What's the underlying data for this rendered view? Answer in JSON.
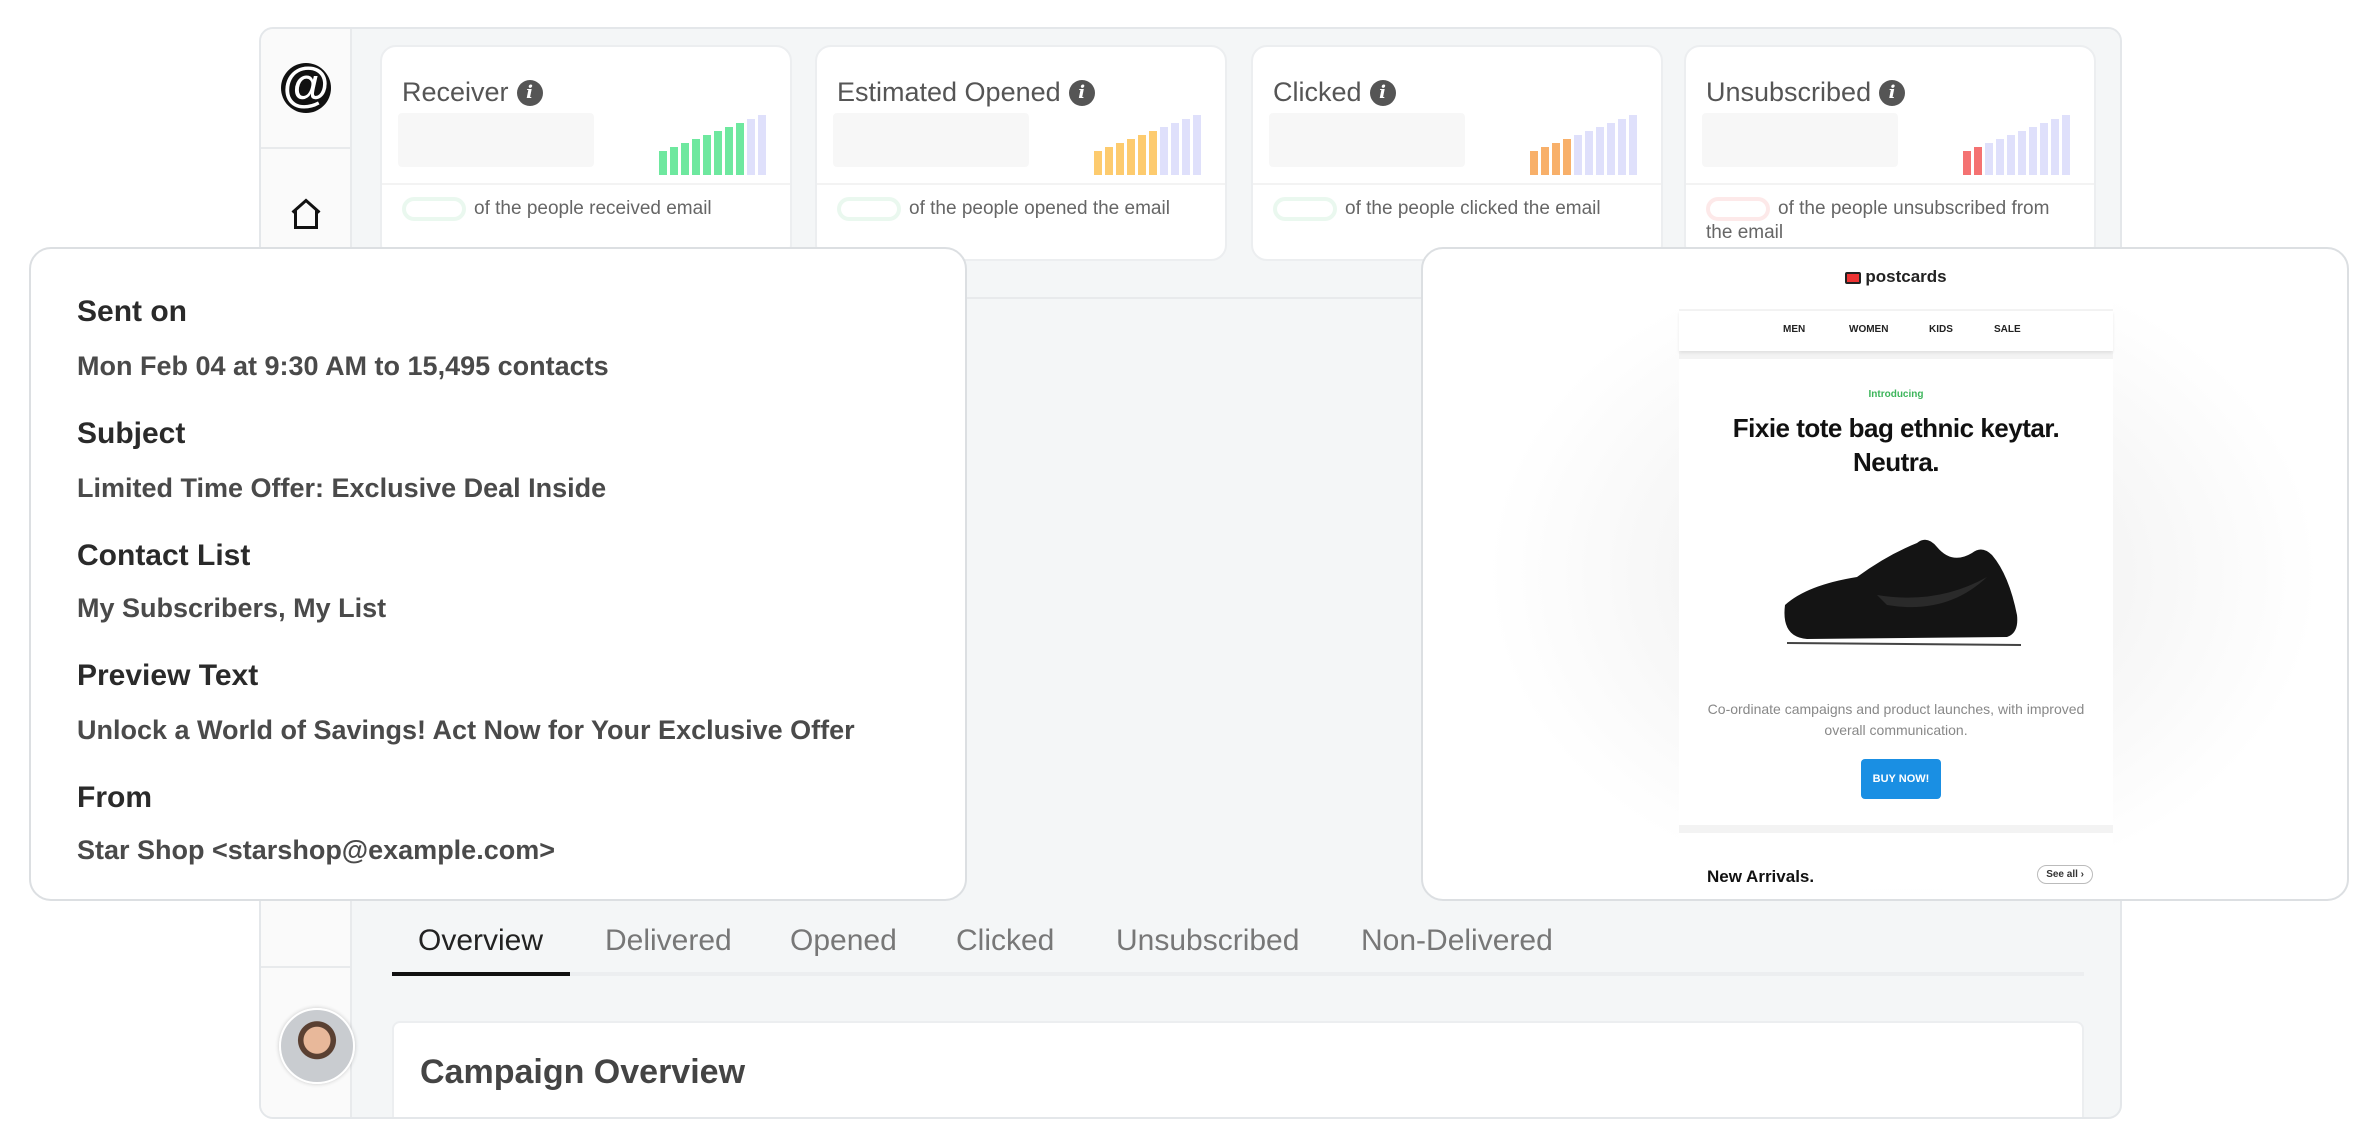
{
  "sidebar": {
    "logo": "@",
    "items": [
      {
        "icon": "home-icon"
      }
    ],
    "avatar": "user-avatar"
  },
  "stats": [
    {
      "title": "Receiver",
      "caption": "of the people received email",
      "bars_filled": 8,
      "bars_total": 10,
      "color": "#6ee89f"
    },
    {
      "title": "Estimated Opened",
      "caption": "of the people opened the email",
      "bars_filled": 6,
      "bars_total": 10,
      "color": "#fdcb6e"
    },
    {
      "title": "Clicked",
      "caption": "of the people clicked the email",
      "bars_filled": 4,
      "bars_total": 10,
      "color": "#f8b06a"
    },
    {
      "title": "Unsubscribed",
      "caption": "of the people unsubscribed from the email",
      "bars_filled": 2,
      "bars_total": 10,
      "color": "#f47272"
    }
  ],
  "inactive_bar_color": "#dfe0fb",
  "details": {
    "sent_on_label": "Sent on",
    "sent_on": "Mon Feb 04 at 9:30 AM to 15,495 contacts",
    "subject_label": "Subject",
    "subject": "Limited Time Offer: Exclusive Deal Inside",
    "contact_list_label": "Contact List",
    "contact_list": "My Subscribers, My List",
    "preview_label": "Preview Text",
    "preview": "Unlock a World of Savings! Act Now for Your Exclusive Offer",
    "from_label": "From",
    "from": "Star Shop <starshop@example.com>"
  },
  "email": {
    "brand": "postcards",
    "nav": [
      "MEN",
      "WOMEN",
      "KIDS",
      "SALE"
    ],
    "intro": "Introducing",
    "headline": "Fixie tote bag ethnic keytar. Neutra.",
    "body": "Co-ordinate campaigns and product launches, with improved overall communication.",
    "cta": "BUY NOW!",
    "section": "New Arrivals.",
    "see_all": "See all ›"
  },
  "tabs": [
    {
      "label": "Overview",
      "active": true
    },
    {
      "label": "Delivered"
    },
    {
      "label": "Opened"
    },
    {
      "label": "Clicked"
    },
    {
      "label": "Unsubscribed"
    },
    {
      "label": "Non-Delivered"
    }
  ],
  "overview": {
    "title": "Campaign Overview"
  }
}
